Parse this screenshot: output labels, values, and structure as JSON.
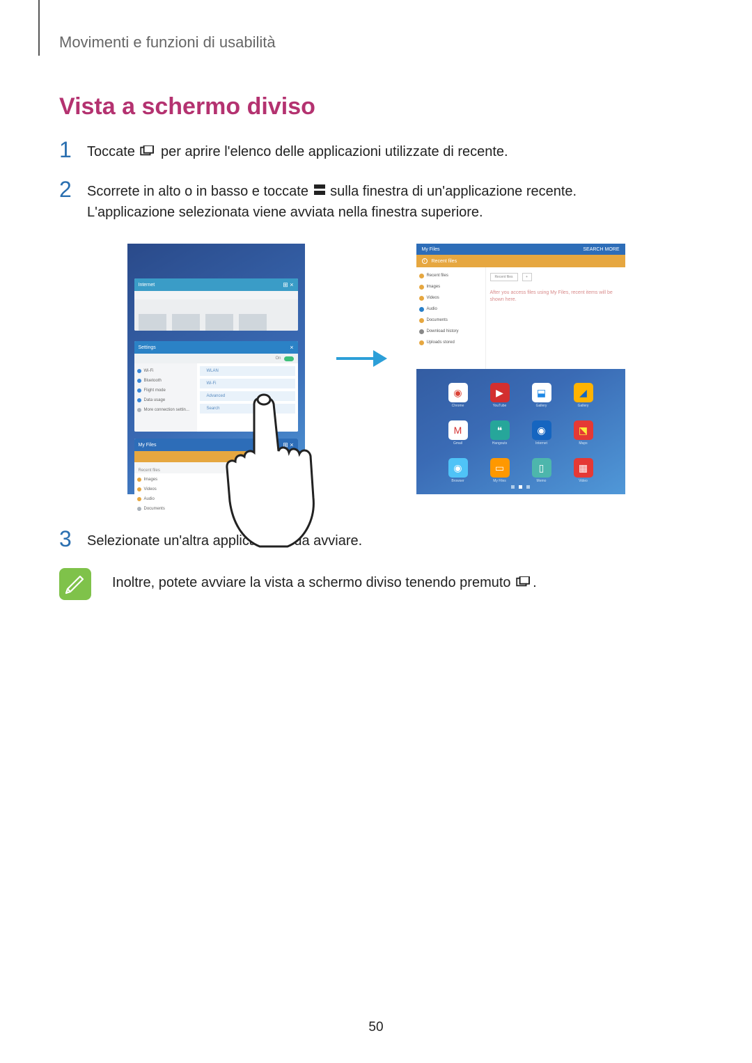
{
  "chapter": "Movimenti e funzioni di usabilità",
  "heading": "Vista a schermo diviso",
  "steps": {
    "s1": {
      "num": "1",
      "before": "Toccate ",
      "after": " per aprire l'elenco delle applicazioni utilizzate di recente."
    },
    "s2": {
      "num": "2",
      "line1_before": "Scorrete in alto o in basso e toccate ",
      "line1_after": " sulla finestra di un'applicazione recente.",
      "line2": "L'applicazione selezionata viene avviata nella finestra superiore."
    },
    "s3": {
      "num": "3",
      "text": "Selezionate un'altra applicazione da avviare."
    }
  },
  "note": {
    "before": "Inoltre, potete avviare la vista a schermo diviso tenendo premuto ",
    "after": "."
  },
  "pageNumber": "50",
  "fig": {
    "left": {
      "win1_title": "Internet",
      "win1_controls": "⊞ ×",
      "win2_title": "Settings",
      "win2_controls": "×",
      "w2_side": [
        "Wi-Fi",
        "Bluetooth",
        "Flight mode",
        "Data usage",
        "More connection settin..."
      ],
      "w2_main": [
        "WLAN",
        "Wi-Fi",
        "Advanced",
        "Search"
      ],
      "win3_title": "My Files",
      "win3_controls": "⊞ ×",
      "w3_tab": "Recent files",
      "w3_rows": [
        "Images",
        "Videos",
        "Audio",
        "Documents"
      ]
    },
    "right": {
      "top_title": "My Files",
      "top_menu": "SEARCH   MORE",
      "sub_label": "Recent files",
      "side": [
        {
          "c": "#e6a740",
          "t": "Recent files"
        },
        {
          "c": "#e6a740",
          "t": "Images"
        },
        {
          "c": "#e6a740",
          "t": "Videos"
        },
        {
          "c": "#2980c9",
          "t": "Audio"
        },
        {
          "c": "#e6a740",
          "t": "Documents"
        },
        {
          "c": "#888",
          "t": "Download history"
        },
        {
          "c": "#e6a740",
          "t": "Uploads stored"
        }
      ],
      "tab_labels": [
        "Recent files",
        "+"
      ],
      "placeholder_text": "After you access files using My Files, recent items will be shown here.",
      "icons": [
        {
          "bg": "#ffffff",
          "fg": "#db4437",
          "g": "◉",
          "l": "Chrome"
        },
        {
          "bg": "#d32f2f",
          "fg": "#fff",
          "g": "▶",
          "l": "YouTube"
        },
        {
          "bg": "#ffffff",
          "fg": "#1e88e5",
          "g": "⬓",
          "l": "Gallery"
        },
        {
          "bg": "#ffb300",
          "fg": "#1565c0",
          "g": "◢",
          "l": "Gallery"
        },
        {
          "bg": "#ffffff",
          "fg": "#d32f2f",
          "g": "M",
          "l": "Gmail"
        },
        {
          "bg": "#26a69a",
          "fg": "#fff",
          "g": "❝",
          "l": "Hangouts"
        },
        {
          "bg": "#1565c0",
          "fg": "#fff",
          "g": "◉",
          "l": "Internet"
        },
        {
          "bg": "#e53935",
          "fg": "#ffeb3b",
          "g": "⬔",
          "l": "Maps"
        },
        {
          "bg": "#4fc3f7",
          "fg": "#fff",
          "g": "◉",
          "l": "Browser"
        },
        {
          "bg": "#ff9800",
          "fg": "#fff",
          "g": "▭",
          "l": "My Files"
        },
        {
          "bg": "#4db6ac",
          "fg": "#fff",
          "g": "▯",
          "l": "Memo"
        },
        {
          "bg": "#e53935",
          "fg": "#fff",
          "g": "▦",
          "l": "Video"
        }
      ]
    }
  }
}
